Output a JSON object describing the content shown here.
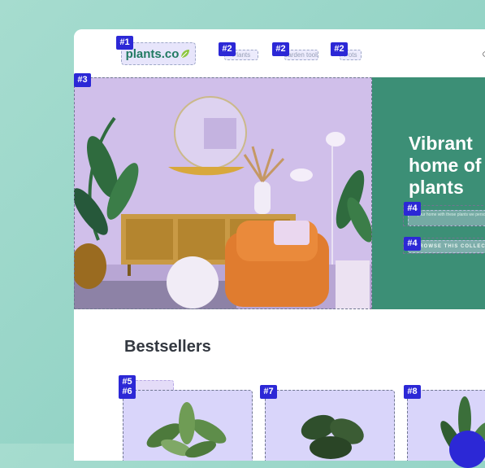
{
  "brand": {
    "logo_text": "plants.co",
    "logo_icon": "leaf-icon",
    "color": "#217a62"
  },
  "nav": {
    "links": [
      {
        "label": "Plants"
      },
      {
        "label": "Garden tools"
      },
      {
        "label": "Pots"
      }
    ]
  },
  "hero": {
    "title": "Vibrant home of plants",
    "description": "Fill your home with these plants we personally curated, only for you",
    "cta_label": "BROWSE THIS COLLECTION",
    "panel_color": "#3c8f76"
  },
  "bestsellers": {
    "heading": "Bestsellers"
  },
  "markers": {
    "logo": "#1",
    "nav_link": "#2",
    "hero_image": "#3",
    "hero_text": "#4",
    "tab": "#5",
    "card_1": "#6",
    "card_2": "#7",
    "card_3": "#8"
  },
  "marker_color": "#2c28d6"
}
